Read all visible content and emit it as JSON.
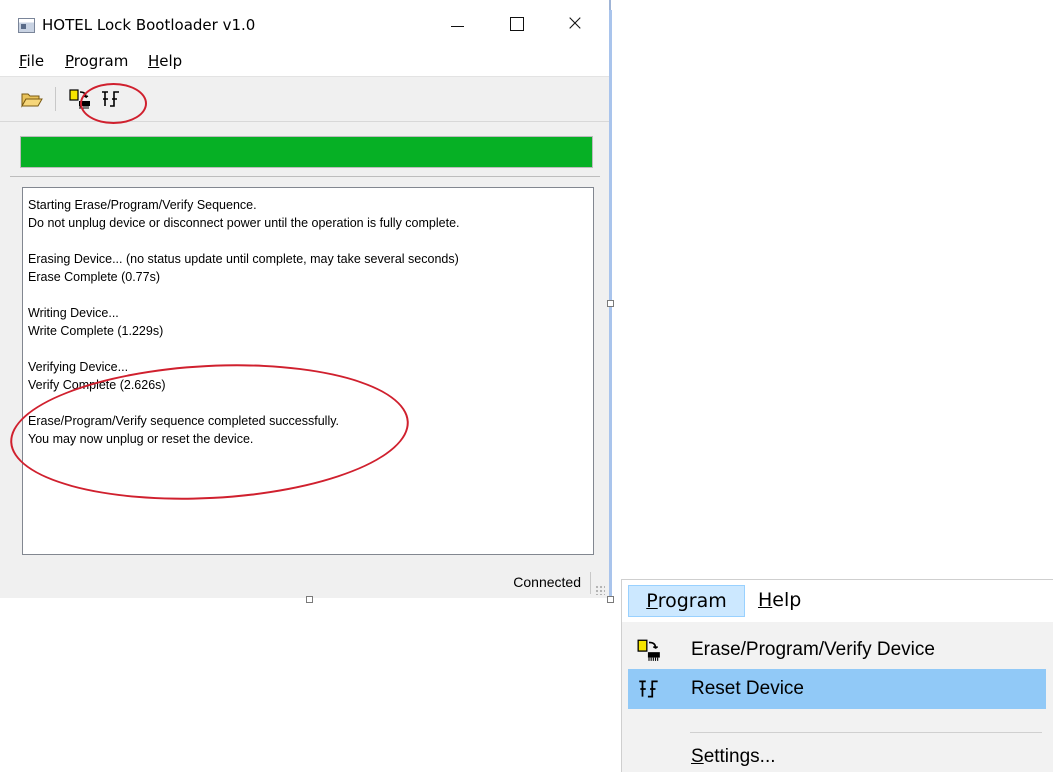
{
  "window": {
    "title": "HOTEL Lock Bootloader v1.0",
    "controls": {
      "minimize": "minimize",
      "maximize": "maximize",
      "close": "×"
    }
  },
  "menubar": {
    "file": {
      "accel": "F",
      "rest": "ile"
    },
    "program": {
      "accel": "P",
      "rest": "rogram"
    },
    "help": {
      "accel": "H",
      "rest": "elp"
    }
  },
  "toolbar": {
    "buttons": [
      {
        "icon": "open-folder-icon",
        "tooltip": ""
      },
      {
        "icon": "erase-program-verify-icon",
        "tooltip": ""
      },
      {
        "icon": "reset-device-icon",
        "tooltip": ""
      }
    ]
  },
  "progress": {
    "value": 1.0,
    "color": "#06b025"
  },
  "log": {
    "lines": [
      "Starting Erase/Program/Verify Sequence.",
      "Do not unplug device or disconnect power until the operation is fully complete.",
      "",
      "Erasing Device... (no status update until complete, may take several seconds)",
      "Erase Complete (0.77s)",
      "",
      "Writing Device...",
      "Write Complete (1.229s)",
      "",
      "Verifying Device...",
      "Verify Complete (2.626s)",
      "",
      "Erase/Program/Verify sequence completed successfully.",
      "You may now unplug or reset the device."
    ]
  },
  "status": {
    "text": "Connected"
  },
  "inset_menu": {
    "program": {
      "accel": "P",
      "rest": "rogram"
    },
    "help": {
      "accel": "H",
      "rest": "elp"
    },
    "items": [
      {
        "label": "Erase/Program/Verify Device",
        "icon": "erase-program-verify-icon",
        "highlighted": false
      },
      {
        "label": "Reset Device",
        "icon": "reset-device-icon",
        "highlighted": true
      },
      {
        "accel": "S",
        "rest": "ettings...",
        "icon": "",
        "highlighted": false
      }
    ]
  },
  "colors": {
    "annotation": "#d0202e",
    "highlight": "#91c9f7",
    "progress": "#06b025"
  }
}
